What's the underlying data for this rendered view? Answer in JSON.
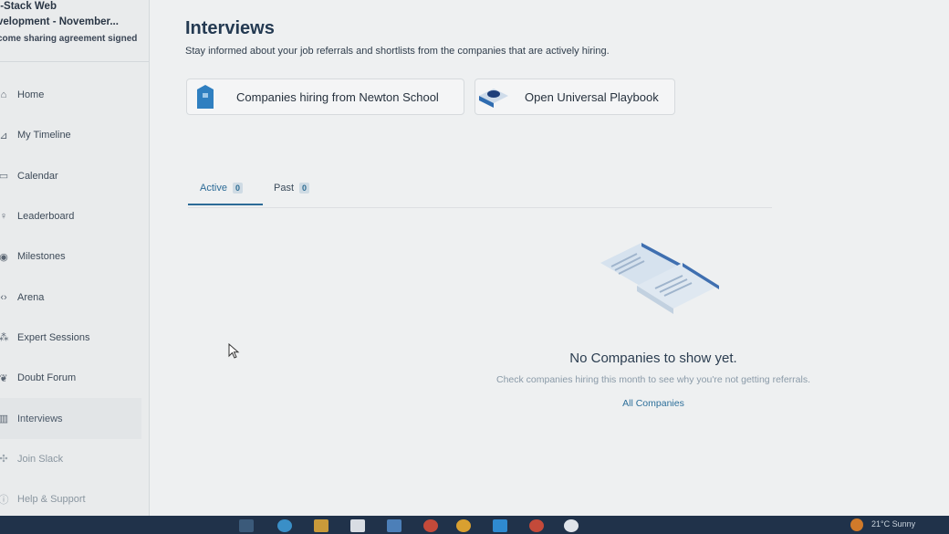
{
  "course": {
    "line1": "l-Stack Web",
    "line2": "velopment - November...",
    "line3": "come sharing agreement signed"
  },
  "nav": [
    {
      "label": "Home",
      "icon": "home-icon"
    },
    {
      "label": "My Timeline",
      "icon": "timeline-icon"
    },
    {
      "label": "Calendar",
      "icon": "calendar-icon"
    },
    {
      "label": "Leaderboard",
      "icon": "trophy-icon"
    },
    {
      "label": "Milestones",
      "icon": "milestone-icon"
    },
    {
      "label": "Arena",
      "icon": "code-icon"
    },
    {
      "label": "Expert Sessions",
      "icon": "people-icon"
    },
    {
      "label": "Doubt Forum",
      "icon": "forum-icon"
    },
    {
      "label": "Interviews",
      "icon": "interviews-icon"
    },
    {
      "label": "Join Slack",
      "icon": "slack-icon"
    },
    {
      "label": "Help & Support",
      "icon": "help-icon"
    }
  ],
  "header": {
    "title": "Interviews",
    "subtitle": "Stay informed about your job referrals and shortlists from the companies that are actively hiring."
  },
  "cards": {
    "companies": "Companies hiring from Newton School",
    "playbook": "Open Universal Playbook"
  },
  "tabs": {
    "active_label": "Active",
    "active_count": "0",
    "past_label": "Past",
    "past_count": "0"
  },
  "empty": {
    "title": "No Companies to show yet.",
    "subtitle": "Check companies hiring this month to see why you're not getting referrals.",
    "link": "All Companies"
  },
  "taskbar": {
    "weather": "21°C  Sunny"
  },
  "colors": {
    "accent": "#2c6b97",
    "taskbar": "#20324a"
  }
}
